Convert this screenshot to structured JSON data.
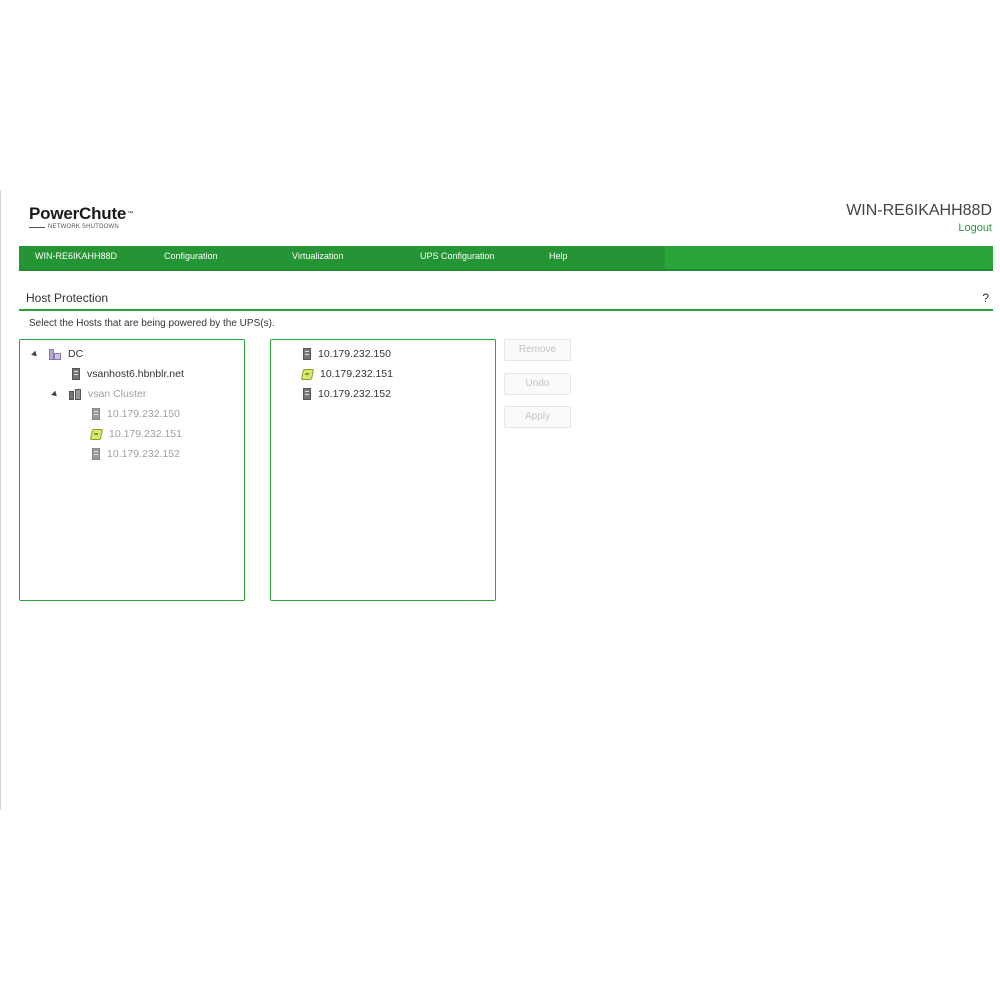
{
  "header": {
    "logo_main": "PowerChute",
    "logo_tm": "™",
    "logo_sub": "NETWORK SHUTDOWN",
    "hostname": "WIN-RE6IKAHH88D",
    "logout": "Logout"
  },
  "nav": {
    "items": [
      {
        "label": "WIN-RE6IKAHH88D"
      },
      {
        "label": "Configuration"
      },
      {
        "label": "Virtualization"
      },
      {
        "label": "UPS Configuration"
      },
      {
        "label": "Help"
      }
    ]
  },
  "section": {
    "title": "Host Protection",
    "help": "?",
    "instructions": "Select the Hosts that are being powered by the UPS(s)."
  },
  "left_tree": {
    "root": {
      "label": "DC",
      "icon": "datacenter-icon"
    },
    "standalone_host": {
      "label": "vsanhost6.hbnblr.net",
      "icon": "server-icon"
    },
    "cluster": {
      "label": "vsan Cluster",
      "icon": "cluster-icon"
    },
    "cluster_hosts": [
      {
        "label": "10.179.232.150",
        "icon": "server-icon"
      },
      {
        "label": "10.179.232.151",
        "icon": "server-warning-icon"
      },
      {
        "label": "10.179.232.152",
        "icon": "server-icon"
      }
    ]
  },
  "right_list": {
    "hosts": [
      {
        "label": "10.179.232.150",
        "icon": "server-icon"
      },
      {
        "label": "10.179.232.151",
        "icon": "server-warning-icon"
      },
      {
        "label": "10.179.232.152",
        "icon": "server-icon"
      }
    ]
  },
  "buttons": {
    "remove": "Remove",
    "undo": "Undo",
    "apply": "Apply"
  },
  "colors": {
    "brand_green": "#2aa33b",
    "disabled_text": "#a0a0a0"
  }
}
